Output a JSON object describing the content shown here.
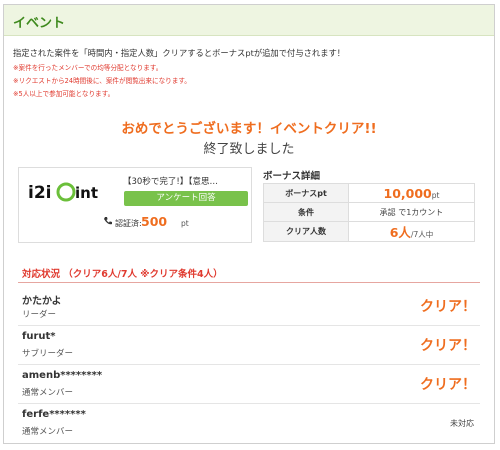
{
  "header": {
    "title": "イベント"
  },
  "description": "指定された案件を「時間内・指定人数」クリアするとボーナスptが追加で付与されます！",
  "notes": [
    "※案件を行ったメンバーでの均等分配となります。",
    "※リクエストから24時間後に、案件が閲覧出来になります。",
    "※5人以上で参加可能となります。"
  ],
  "congrats": "おめでとうございます！イベントクリア!!",
  "ended": "終了致しました",
  "offer": {
    "logo_text": "i2i Point",
    "title": "【30秒で完了!】【意思…",
    "button_label": "アンケート回答",
    "cert_label": "認証済:",
    "points": "500",
    "points_unit": "pt"
  },
  "bonus": {
    "title": "ボーナス詳細",
    "rows": [
      {
        "key": "ボーナスpt",
        "value": "10,000",
        "unit": "pt"
      },
      {
        "key": "条件",
        "value": "承認 で1カウント"
      },
      {
        "key": "クリア人数",
        "value": "6人",
        "unit": "/7人中"
      }
    ]
  },
  "status": {
    "heading": "対応状況 （クリア6人/7人 ※クリア条件4人）"
  },
  "members": [
    {
      "name": "かたかよ",
      "role": "リーダー",
      "state": "クリア！"
    },
    {
      "name": "furut*",
      "role": "サブリーダー",
      "state": "クリア！"
    },
    {
      "name": "amenb********",
      "role": "通常メンバー",
      "state": "クリア！"
    },
    {
      "name": "ferfe*******",
      "role": "通常メンバー",
      "state": "未対応"
    }
  ],
  "colors": {
    "accent": "#ef6d1f",
    "green": "#79c24b",
    "alert": "#e03a2f"
  }
}
